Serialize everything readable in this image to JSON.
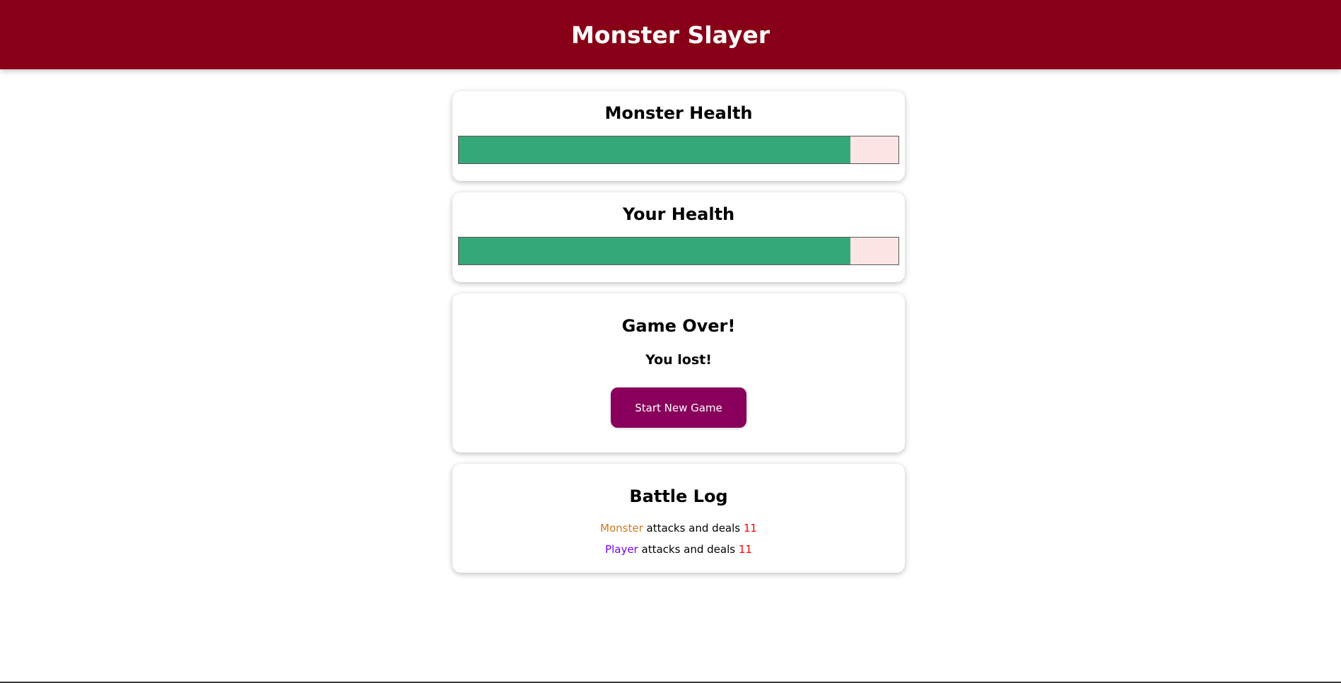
{
  "app": {
    "title": "Monster Slayer"
  },
  "monster_health": {
    "title": "Monster Health",
    "percent": 89
  },
  "player_health": {
    "title": "Your Health",
    "percent": 89
  },
  "game_over": {
    "title": "Game Over!",
    "result": "You lost!",
    "button_label": "Start New Game"
  },
  "battle_log": {
    "title": "Battle Log",
    "entries": [
      {
        "actor": "Monster",
        "text": " attacks and deals ",
        "value": "11"
      },
      {
        "actor": "Player",
        "text": " attacks and deals ",
        "value": "11"
      }
    ]
  },
  "colors": {
    "header": "#880017",
    "health_fill": "#35a877",
    "health_empty": "#fde5e5",
    "button": "#88005b",
    "monster_name": "#cc7a1e",
    "player_name": "#7700ff",
    "damage": "#ff0000"
  }
}
